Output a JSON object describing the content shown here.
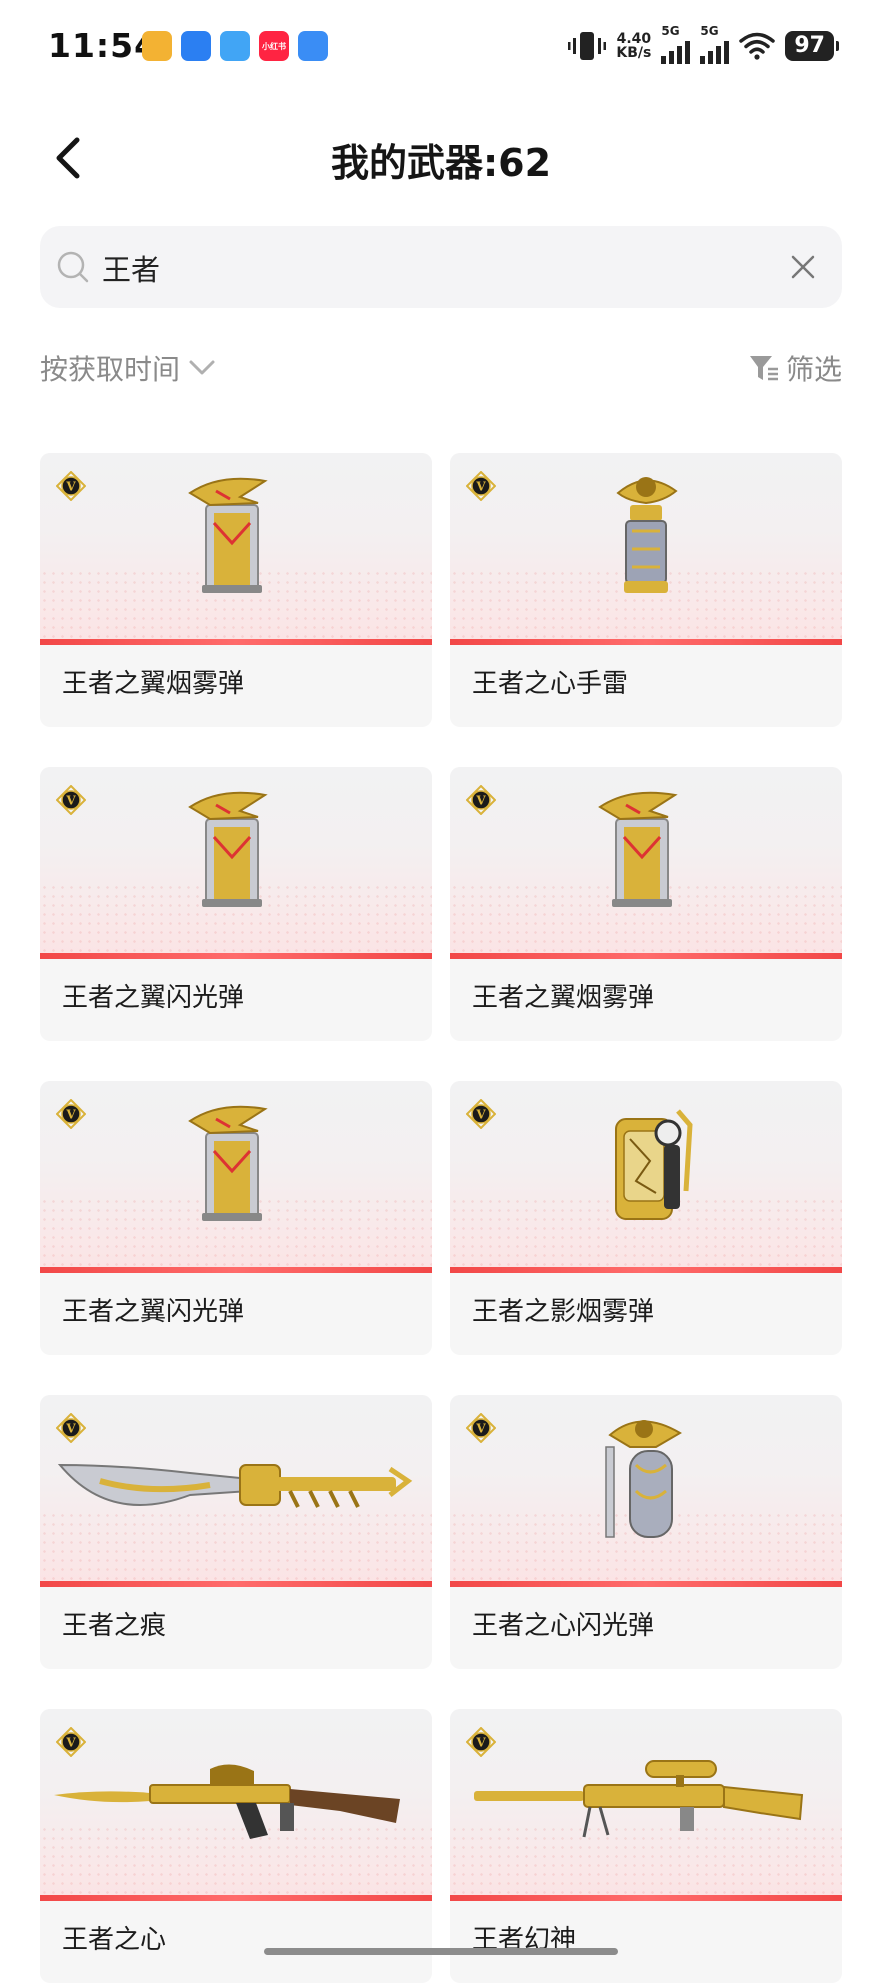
{
  "status": {
    "time": "11:54",
    "net_speed_top": "4.40",
    "net_speed_unit": "KB/s",
    "sim1_label": "5G",
    "sim2_label": "5G",
    "battery": "97",
    "app_icons": [
      {
        "icon": "coin-app-icon",
        "color": "#f3b233",
        "label": ""
      },
      {
        "icon": "browser-app-icon",
        "color": "#2b7ff2",
        "label": ""
      },
      {
        "icon": "cloud-app-icon",
        "color": "#41a5f5",
        "label": ""
      },
      {
        "icon": "xiaohongshu-app-icon",
        "color": "#ff2442",
        "label": "小红书"
      },
      {
        "icon": "game-app-icon",
        "color": "#3a8df5",
        "label": ""
      }
    ]
  },
  "header": {
    "title": "我的武器:62"
  },
  "search": {
    "value": "王者"
  },
  "toolbar": {
    "sort_label": "按获取时间",
    "filter_label": "筛选"
  },
  "items": [
    {
      "name": "王者之翼烟雾弹",
      "kind": "canister-wing"
    },
    {
      "name": "王者之心手雷",
      "kind": "grenade-heart"
    },
    {
      "name": "王者之翼闪光弹",
      "kind": "canister-wing"
    },
    {
      "name": "王者之翼烟雾弹",
      "kind": "canister-wing"
    },
    {
      "name": "王者之翼闪光弹",
      "kind": "canister-wing"
    },
    {
      "name": "王者之影烟雾弹",
      "kind": "canister-shadow"
    },
    {
      "name": "王者之痕",
      "kind": "blade"
    },
    {
      "name": "王者之心闪光弹",
      "kind": "flash-heart"
    },
    {
      "name": "王者之心",
      "kind": "rifle"
    },
    {
      "name": "王者幻神",
      "kind": "sniper"
    }
  ],
  "colors": {
    "accent_red": "#f24747",
    "gold": "#d9b23a",
    "text_gray": "#8a8a8a"
  }
}
